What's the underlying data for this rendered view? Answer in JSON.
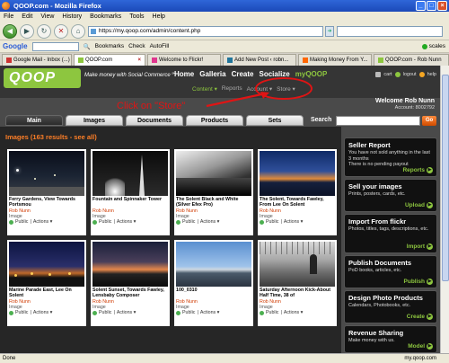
{
  "window": {
    "title": "QOOP.com - Mozilla Firefox"
  },
  "menu": [
    "File",
    "Edit",
    "View",
    "History",
    "Bookmarks",
    "Tools",
    "Help"
  ],
  "nav": {
    "url": "https://my.qoop.com/admin/content.php"
  },
  "google_bar": {
    "logo": "Google",
    "bookmarks": "Bookmarks",
    "check": "Check",
    "autofill": "AutoFill",
    "scales": "scales"
  },
  "tabs": [
    {
      "label": "Google Mail - Inbox (...)"
    },
    {
      "label": "QOOP.com"
    },
    {
      "label": "Welcome to Flickr!"
    },
    {
      "label": "Add New Post ‹ robn..."
    },
    {
      "label": "Making Money From Y..."
    },
    {
      "label": "QOOP.com - Rob Nunn"
    }
  ],
  "site": {
    "logo": "QOOP",
    "tagline": "Make money with Social Commerce℠",
    "mainnav": [
      "Home",
      "Galleria",
      "Create",
      "Socialize",
      "myQOOP"
    ],
    "toplinks": [
      "cart",
      "logout",
      "help"
    ],
    "subnav": {
      "content": "Content ▾",
      "reports": "Reports",
      "account": "Account ▾",
      "store": "Store ▾"
    },
    "annotation": "Click on \"Store\"",
    "welcome": "Welcome Rob Nunn",
    "account": "Account: 8002792",
    "tabs": [
      "Main",
      "Images",
      "Documents",
      "Products",
      "Sets"
    ],
    "search_label": "Search",
    "go": "Go",
    "heading": "Images (163 results - see all)",
    "images": [
      {
        "title": "Ferry Gardens, View Towards Portsmou",
        "author": "Rob Nunn",
        "type": "Image",
        "status": "Public",
        "actions": "Actions ▾"
      },
      {
        "title": "Fountain and Spinnaker Tower",
        "author": "Rob Nunn",
        "type": "Image",
        "status": "Public",
        "actions": "Actions ▾"
      },
      {
        "title": "The Solent Black and White (Silver Efex Pro)",
        "author": "Rob Nunn",
        "type": "Image",
        "status": "Public",
        "actions": "Actions ▾"
      },
      {
        "title": "The Solent, Towards Fawley, From Lee On Solent",
        "author": "Rob Nunn",
        "type": "Image",
        "status": "Public",
        "actions": "Actions ▾"
      },
      {
        "title": "Marine Parade East, Lee On Solent",
        "author": "Rob Nunn",
        "type": "Image",
        "status": "Public",
        "actions": "Actions ▾"
      },
      {
        "title": "Solent Sunset, Towards Fawley, Lensbaby Composer",
        "author": "Rob Nunn",
        "type": "Image",
        "status": "Public",
        "actions": "Actions ▾"
      },
      {
        "title": "100_0310",
        "author": "Rob Nunn",
        "type": "Image",
        "status": "Public",
        "actions": "Actions ▾"
      },
      {
        "title": "Saturday Afternoon Kick-About Half Time, 38 of",
        "author": "Rob Nunn",
        "type": "Image",
        "status": "Public",
        "actions": "Actions ▾"
      }
    ],
    "sidebar": [
      {
        "title": "Seller Report",
        "text": "You have not sold anything in the last 3 months\nThere is no pending payout",
        "action": "Reports"
      },
      {
        "title": "Sell your images",
        "text": "Prints, posters, cards, etc.",
        "action": "Upload"
      },
      {
        "title": "Import From flickr",
        "text": "Photos, titles, tags, descriptions, etc.",
        "action": "Import"
      },
      {
        "title": "Publish Documents",
        "text": "PoD books, articles, etc.",
        "action": "Publish"
      },
      {
        "title": "Design Photo Products",
        "text": "Calendars, Photobooks, etc.",
        "action": "Create"
      },
      {
        "title": "Revenue Sharing",
        "text": "Make money with us.",
        "action": "Model"
      }
    ]
  },
  "status": {
    "left": "Done",
    "right": "my.qoop.com"
  }
}
